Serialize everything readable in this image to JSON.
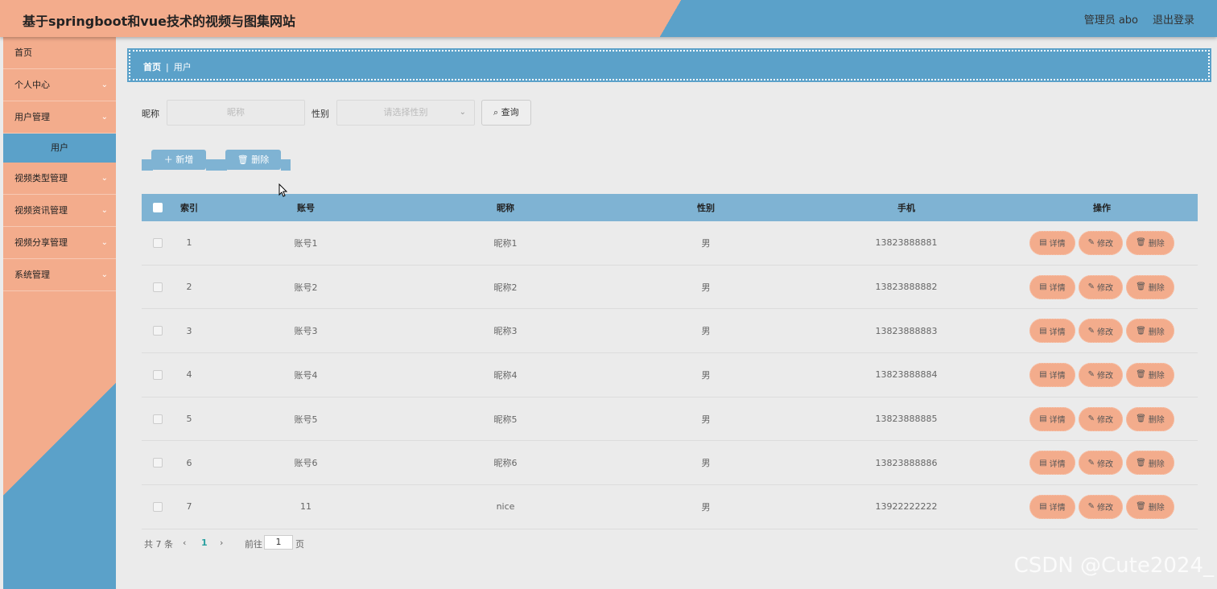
{
  "header": {
    "title": "基于springboot和vue技术的视频与图集网站",
    "user": "管理员 abo",
    "logout": "退出登录"
  },
  "sidebar": {
    "items": [
      {
        "label": "首页"
      },
      {
        "label": "个人中心"
      },
      {
        "label": "用户管理"
      },
      {
        "label": "用户"
      },
      {
        "label": "视频类型管理"
      },
      {
        "label": "视频资讯管理"
      },
      {
        "label": "视频分享管理"
      },
      {
        "label": "系统管理"
      }
    ]
  },
  "breadcrumb": {
    "home": "首页",
    "current": "用户"
  },
  "search": {
    "nickname_label": "昵称",
    "nickname_placeholder": "昵称",
    "gender_label": "性别",
    "gender_placeholder": "请选择性别",
    "query_label": "查询"
  },
  "actions": {
    "add_label": "新增",
    "delete_label": "删除"
  },
  "table": {
    "headers": [
      "索引",
      "账号",
      "昵称",
      "性别",
      "手机",
      "操作"
    ],
    "rows": [
      {
        "index": "1",
        "account": "账号1",
        "nickname": "昵称1",
        "gender": "男",
        "phone": "13823888881"
      },
      {
        "index": "2",
        "account": "账号2",
        "nickname": "昵称2",
        "gender": "男",
        "phone": "13823888882"
      },
      {
        "index": "3",
        "account": "账号3",
        "nickname": "昵称3",
        "gender": "男",
        "phone": "13823888883"
      },
      {
        "index": "4",
        "account": "账号4",
        "nickname": "昵称4",
        "gender": "男",
        "phone": "13823888884"
      },
      {
        "index": "5",
        "account": "账号5",
        "nickname": "昵称5",
        "gender": "男",
        "phone": "13823888885"
      },
      {
        "index": "6",
        "account": "账号6",
        "nickname": "昵称6",
        "gender": "男",
        "phone": "13823888886"
      },
      {
        "index": "7",
        "account": "11",
        "nickname": "nice",
        "gender": "男",
        "phone": "13922222222"
      }
    ],
    "op_detail": "详情",
    "op_edit": "修改",
    "op_delete": "删除"
  },
  "pager": {
    "total": "共 7 条",
    "prev": "‹",
    "page": "1",
    "next": "›",
    "goto_label": "前往",
    "goto_value": "1",
    "page_unit": "页"
  },
  "watermark": "CSDN @Cute2024_",
  "colors": {
    "salmon": "#f3ac8c",
    "blue": "#5ba1c9",
    "table_head": "#7fb3d3"
  }
}
